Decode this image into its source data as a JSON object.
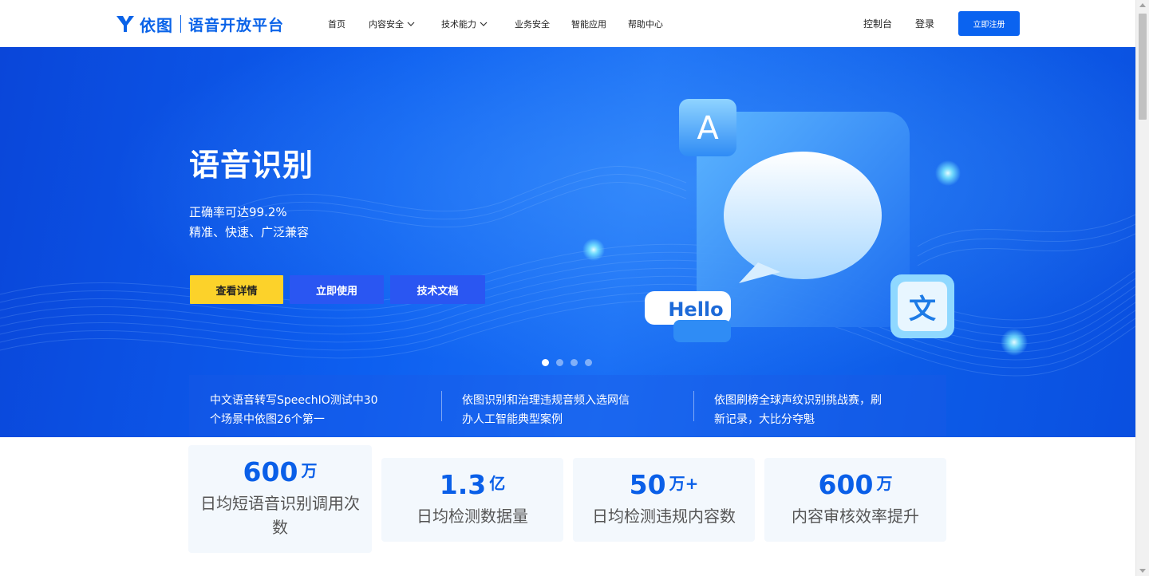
{
  "brand": {
    "name": "依图",
    "subtitle": "语音开放平台",
    "color": "#0a63e8"
  },
  "nav": {
    "items": [
      {
        "label": "首页",
        "has_dropdown": false
      },
      {
        "label": "内容安全",
        "has_dropdown": true
      },
      {
        "label": "技术能力",
        "has_dropdown": true
      },
      {
        "label": "业务安全",
        "has_dropdown": false
      },
      {
        "label": "智能应用",
        "has_dropdown": false
      },
      {
        "label": "帮助中心",
        "has_dropdown": false
      }
    ],
    "console_label": "控制台",
    "login_label": "登录",
    "register_label": "立即注册",
    "dropdown_icon": "chevron-down-icon"
  },
  "hero": {
    "title": "语音识别",
    "subtitle_line1": "正确率可达99.2%",
    "subtitle_line2": "精准、快速、广泛兼容",
    "buttons": {
      "detail": "查看详情",
      "use": "立即使用",
      "docs": "技术文档"
    },
    "illustration": {
      "letter_tile": "A",
      "hello_tag": "Hello",
      "wen_tile": "文"
    },
    "carousel": {
      "total": 4,
      "active_index": 1
    },
    "colors": {
      "detail_button": "#fcd22a",
      "secondary_button": "#2a56f2",
      "hero_bg": "#0d5ff0"
    }
  },
  "news": [
    {
      "line1": "中文语音转写SpeechIO测试中30",
      "line2": "个场景中依图26个第一"
    },
    {
      "line1": "依图识别和治理违规音频入选网信",
      "line2": "办人工智能典型案例"
    },
    {
      "line1": "依图刷榜全球声纹识别挑战赛，刷",
      "line2": "新记录，大比分夺魁"
    }
  ],
  "stats": [
    {
      "value": "600",
      "unit": "万",
      "label": "日均短语音识别调用次数"
    },
    {
      "value": "1.3",
      "unit": "亿",
      "label": "日均检测数据量"
    },
    {
      "value": "50",
      "unit": "万+",
      "label": "日均检测违规内容数"
    },
    {
      "value": "600",
      "unit": "万",
      "label": "内容审核效率提升"
    }
  ]
}
